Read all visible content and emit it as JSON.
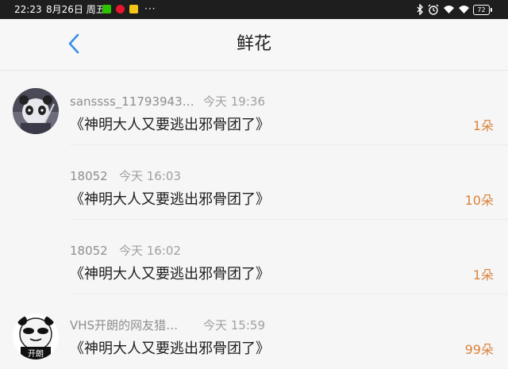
{
  "status_bar": {
    "time": "22:23",
    "date": "8月26日 周五",
    "more": "···",
    "battery": "72"
  },
  "header": {
    "title": "鲜花",
    "back_icon": "chevron-left-icon",
    "accent_color": "#3a8ee6"
  },
  "gifts": [
    {
      "user": "sanssss_11793943…",
      "time": "今天 19:36",
      "book": "《神明大人又要逃出邪骨团了》",
      "count": "1朵",
      "avatar": "panda-avatar-icon"
    },
    {
      "user": "18052",
      "time": "今天 16:03",
      "book": "《神明大人又要逃出邪骨团了》",
      "count": "10朵",
      "avatar": ""
    },
    {
      "user": "18052",
      "time": "今天 16:02",
      "book": "《神明大人又要逃出邪骨团了》",
      "count": "1朵",
      "avatar": ""
    },
    {
      "user": "VHS开朗的网友猎…",
      "time": "今天 15:59",
      "book": "《神明大人又要逃出邪骨团了》",
      "count": "99朵",
      "avatar": "cartoon-avatar-icon",
      "avatar_text": "开朗"
    }
  ],
  "count_color": "#d8833a"
}
